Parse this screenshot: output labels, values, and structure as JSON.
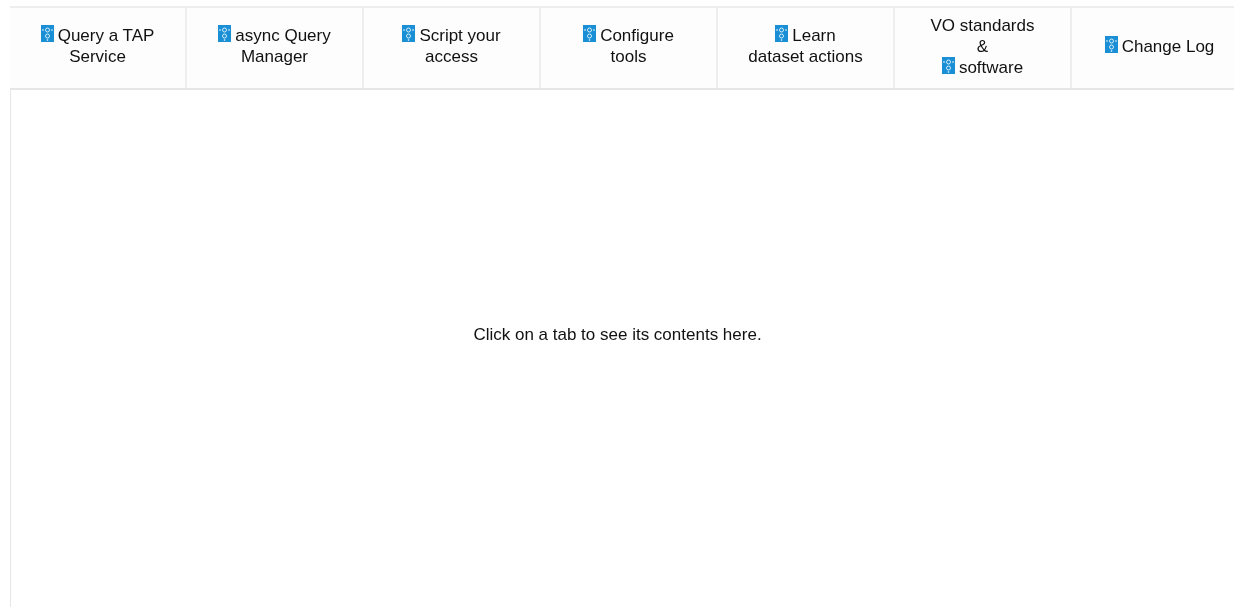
{
  "tabs": [
    {
      "label": "Query a TAP Service"
    },
    {
      "label": "async Query Manager"
    },
    {
      "label": "Script your access"
    },
    {
      "label": "Configure tools"
    },
    {
      "label": "Learn dataset actions"
    },
    {
      "label_before_icon": "VO standards &",
      "label": "software"
    },
    {
      "label": "Change Log"
    }
  ],
  "panel": {
    "message": "Click on a tab to see its contents here."
  }
}
